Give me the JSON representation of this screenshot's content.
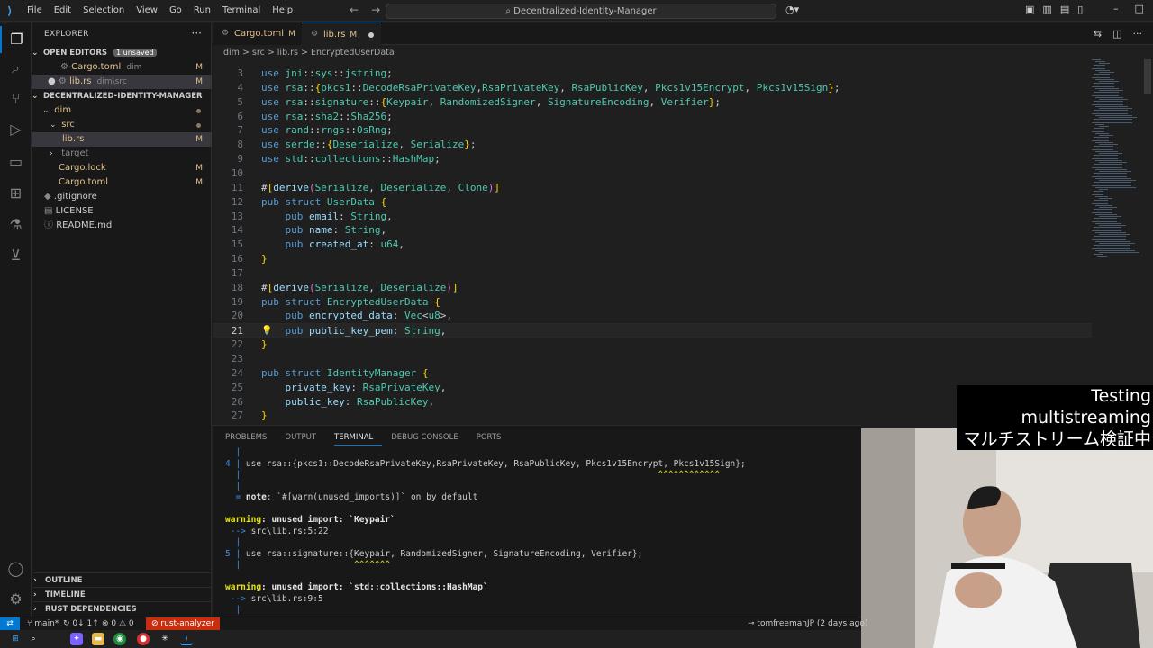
{
  "titlebar": {
    "menu": [
      "File",
      "Edit",
      "Selection",
      "View",
      "Go",
      "Run",
      "Terminal",
      "Help"
    ],
    "search_text": "Decentralized-Identity-Manager"
  },
  "sidebar": {
    "title": "EXPLORER",
    "open_editors_label": "OPEN EDITORS",
    "unsaved_badge": "1 unsaved",
    "open_editors": [
      {
        "name": "Cargo.toml",
        "sub": "dim",
        "status": "M"
      },
      {
        "name": "lib.rs",
        "sub": "dim\\src",
        "status": "M"
      }
    ],
    "project_label": "DECENTRALIZED-IDENTITY-MANAGER",
    "tree": [
      {
        "name": "dim"
      },
      {
        "name": "src"
      },
      {
        "name": "lib.rs",
        "status": "M"
      },
      {
        "name": "target"
      },
      {
        "name": "Cargo.lock",
        "status": "M"
      },
      {
        "name": "Cargo.toml",
        "status": "M"
      },
      {
        "name": ".gitignore"
      },
      {
        "name": "LICENSE"
      },
      {
        "name": "README.md"
      }
    ],
    "bottom_sections": [
      "OUTLINE",
      "TIMELINE",
      "RUST DEPENDENCIES"
    ]
  },
  "tabs": [
    {
      "label": "Cargo.toml",
      "status": "M"
    },
    {
      "label": "lib.rs",
      "status": "M"
    }
  ],
  "breadcrumb": "dim > src > lib.rs > EncryptedUserData",
  "editor": {
    "lines": [
      {
        "n": "3",
        "html": "<span class=\"k\">use</span> <span class=\"m\">jni</span>::<span class=\"m\">sys</span>::<span class=\"t\">jstring</span>;"
      },
      {
        "n": "4",
        "html": "<span class=\"k\">use</span> <span class=\"m\">rsa</span>::<span class=\"b1\">{</span><span class=\"m\">pkcs1</span>::<span class=\"t\">DecodeRsaPrivateKey</span>,<span class=\"t\">RsaPrivateKey</span>, <span class=\"t\">RsaPublicKey</span>, <span class=\"t\">Pkcs1v15Encrypt</span>, <span class=\"t\">Pkcs1v15Sign</span><span class=\"b1\">}</span>;"
      },
      {
        "n": "5",
        "html": "<span class=\"k\">use</span> <span class=\"m\">rsa</span>::<span class=\"m\">signature</span>::<span class=\"b1\">{</span><span class=\"t\">Keypair</span>, <span class=\"t\">RandomizedSigner</span>, <span class=\"t\">SignatureEncoding</span>, <span class=\"t\">Verifier</span><span class=\"b1\">}</span>;"
      },
      {
        "n": "6",
        "html": "<span class=\"k\">use</span> <span class=\"m\">rsa</span>::<span class=\"m\">sha2</span>::<span class=\"t\">Sha256</span>;"
      },
      {
        "n": "7",
        "html": "<span class=\"k\">use</span> <span class=\"m\">rand</span>::<span class=\"m\">rngs</span>::<span class=\"t\">OsRng</span>;"
      },
      {
        "n": "8",
        "html": "<span class=\"k\">use</span> <span class=\"m\">serde</span>::<span class=\"b1\">{</span><span class=\"t\">Deserialize</span>, <span class=\"t\">Serialize</span><span class=\"b1\">}</span>;"
      },
      {
        "n": "9",
        "html": "<span class=\"k\">use</span> <span class=\"m\">std</span>::<span class=\"m\">collections</span>::<span class=\"t\">HashMap</span>;"
      },
      {
        "n": "10",
        "html": ""
      },
      {
        "n": "11",
        "html": "<span class=\"a\">#</span><span class=\"b1\">[</span><span class=\"f\">derive</span><span class=\"b2\">(</span><span class=\"t\">Serialize</span>, <span class=\"t\">Deserialize</span>, <span class=\"t\">Clone</span><span class=\"b2\">)</span><span class=\"b1\">]</span>"
      },
      {
        "n": "12",
        "html": "<span class=\"k\">pub</span> <span class=\"k\">struct</span> <span class=\"t\">UserData</span> <span class=\"b1\">{</span>"
      },
      {
        "n": "13",
        "html": "    <span class=\"k\">pub</span> <span class=\"f\">email</span>: <span class=\"t\">String</span>,"
      },
      {
        "n": "14",
        "html": "    <span class=\"k\">pub</span> <span class=\"f\">name</span>: <span class=\"t\">String</span>,"
      },
      {
        "n": "15",
        "html": "    <span class=\"k\">pub</span> <span class=\"f\">created_at</span>: <span class=\"t\">u64</span>,"
      },
      {
        "n": "16",
        "html": "<span class=\"b1\">}</span>"
      },
      {
        "n": "17",
        "html": ""
      },
      {
        "n": "18",
        "html": "<span class=\"a\">#</span><span class=\"b1\">[</span><span class=\"f\">derive</span><span class=\"b2\">(</span><span class=\"t\">Serialize</span>, <span class=\"t\">Deserialize</span><span class=\"b2\">)</span><span class=\"b1\">]</span>"
      },
      {
        "n": "19",
        "html": "<span class=\"k\">pub</span> <span class=\"k\">struct</span> <span class=\"t\">EncryptedUserData</span> <span class=\"b1\">{</span>"
      },
      {
        "n": "20",
        "html": "    <span class=\"k\">pub</span> <span class=\"f\">encrypted_data</span>: <span class=\"t\">Vec</span>&lt;<span class=\"t\">u8</span>&gt;,"
      },
      {
        "n": "21",
        "html": "    <span class=\"k\">pub</span> <span class=\"f\">public_key_pem</span>: <span class=\"t\">String</span>,",
        "current": true
      },
      {
        "n": "22",
        "html": "<span class=\"b1\">}</span>"
      },
      {
        "n": "23",
        "html": ""
      },
      {
        "n": "24",
        "html": "<span class=\"k\">pub</span> <span class=\"k\">struct</span> <span class=\"t\">IdentityManager</span> <span class=\"b1\">{</span>"
      },
      {
        "n": "25",
        "html": "    <span class=\"f\">private_key</span>: <span class=\"t\">RsaPrivateKey</span>,"
      },
      {
        "n": "26",
        "html": "    <span class=\"f\">public_key</span>: <span class=\"t\">RsaPublicKey</span>,"
      },
      {
        "n": "27",
        "html": "<span class=\"b1\">}</span>"
      }
    ]
  },
  "panel": {
    "tabs": [
      "PROBLEMS",
      "OUTPUT",
      "TERMINAL",
      "DEBUG CONSOLE",
      "PORTS"
    ],
    "active_tab": "TERMINAL",
    "terminal": [
      {
        "html": "  <span class=\"pipe\">|</span>"
      },
      {
        "html": "<span class=\"pipe\">4</span> <span class=\"pipe\">|</span> use rsa::{pkcs1::DecodeRsaPrivateKey,RsaPrivateKey, RsaPublicKey, Pkcs1v15Encrypt, Pkcs1v15Sign};"
      },
      {
        "html": "  <span class=\"pipe\">|</span>                                                                                 <span class=\"careta\">^^^^^^^^^^^^</span>"
      },
      {
        "html": "  <span class=\"pipe\">|</span>"
      },
      {
        "html": "  <span class=\"pipe\">=</span> <span class=\"bold\">note</span>: `#[warn(unused_imports)]` on by default"
      },
      {
        "html": ""
      },
      {
        "html": "<span class=\"warn\">warning</span><span class=\"bold\">: unused import: `Keypair`</span>"
      },
      {
        "html": " <span class=\"pipe\">--&gt;</span> src\\lib.rs:5:22"
      },
      {
        "html": "  <span class=\"pipe\">|</span>"
      },
      {
        "html": "<span class=\"pipe\">5</span> <span class=\"pipe\">|</span> use rsa::signature::{Keypair, RandomizedSigner, SignatureEncoding, Verifier};"
      },
      {
        "html": "  <span class=\"pipe\">|</span>                      <span class=\"careta\">^^^^^^^</span>"
      },
      {
        "html": ""
      },
      {
        "html": "<span class=\"warn\">warning</span><span class=\"bold\">: unused import: `std::collections::HashMap`</span>"
      },
      {
        "html": " <span class=\"pipe\">--&gt;</span> src\\lib.rs:9:5"
      },
      {
        "html": "  <span class=\"pipe\">|</span>"
      }
    ]
  },
  "statusbar": {
    "branch": "main*",
    "sync": "0↓ 1↑",
    "problems": "⊗ 0 ⚠ 0",
    "rust_analyzer": "rust-analyzer",
    "blame": "tomfreemanJP (2 days ago)"
  },
  "overlay": {
    "line1": "Testing multistreaming",
    "line2": "マルチストリーム検証中"
  }
}
